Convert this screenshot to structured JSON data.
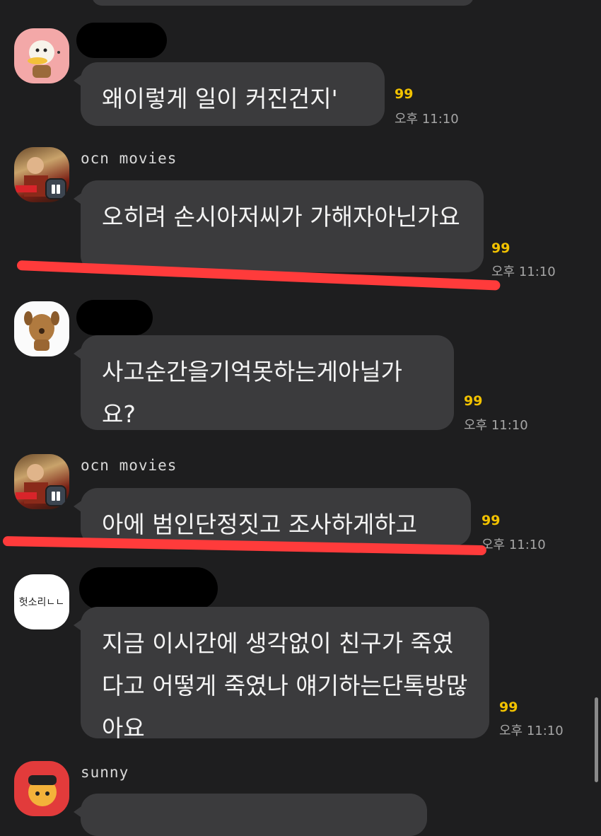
{
  "messages": [
    {
      "sender": "",
      "text": "왜이렇게 일이 커진건지'",
      "unread": "99",
      "time": "오후 11:10"
    },
    {
      "sender": "ocn movies",
      "text": "오히려 손시아저씨가  가해자아닌가요",
      "unread": "99",
      "time": "오후 11:10"
    },
    {
      "sender": "",
      "text": "사고순간을기억못하는게아닐가요?",
      "unread": "99",
      "time": "오후 11:10"
    },
    {
      "sender": "ocn movies",
      "text": "아에 범인단정짓고 조사하게하고",
      "unread": "99",
      "time": "오후 11:10"
    },
    {
      "sender": "",
      "avatar_text": "헛소리ㄴㄴ",
      "text": "지금 이시간에 생각없이 친구가 죽였다고 어떻게 죽였나 얘기하는단톡방많아요",
      "unread": "99",
      "time": "오후 11:10"
    },
    {
      "sender": "sunny"
    }
  ],
  "colors": {
    "background": "#1e1e1f",
    "bubble": "#3b3b3d",
    "unread": "#f2c200",
    "highlight": "#ff3b3b"
  }
}
